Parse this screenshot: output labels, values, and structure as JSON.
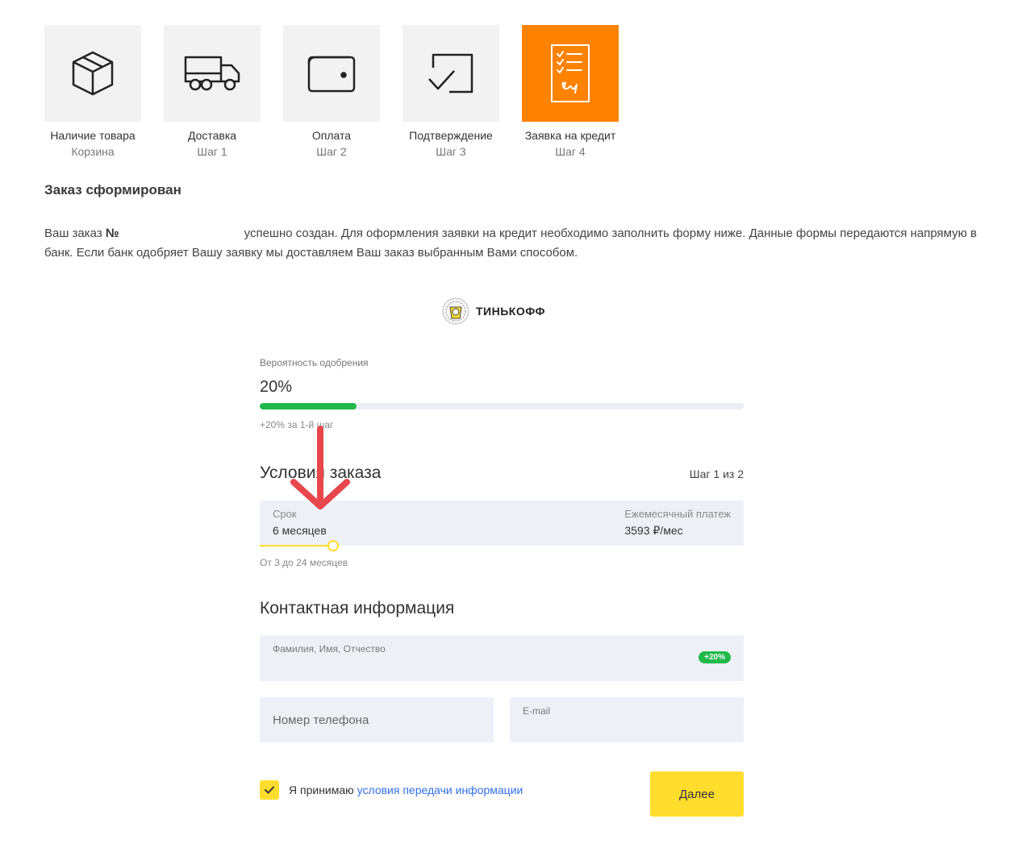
{
  "steps": [
    {
      "title": "Наличие товара",
      "sub": "Корзина",
      "icon": "box-icon",
      "active": false
    },
    {
      "title": "Доставка",
      "sub": "Шаг 1",
      "icon": "truck-icon",
      "active": false
    },
    {
      "title": "Оплата",
      "sub": "Шаг 2",
      "icon": "wallet-icon",
      "active": false
    },
    {
      "title": "Подтверждение",
      "sub": "Шаг 3",
      "icon": "confirm-icon",
      "active": false
    },
    {
      "title": "Заявка на кредит",
      "sub": "Шаг 4",
      "icon": "credit-application-icon",
      "active": true
    }
  ],
  "order": {
    "heading": "Заказ сформирован",
    "text_before": "Ваш заказ ",
    "number_label": "№",
    "text_after": "успешно создан. Для оформления заявки на кредит необходимо заполнить форму ниже. Данные формы передаются напрямую в банк. Если банк одобряет Вашу заявку мы доставляем Ваш заказ выбранным Вами способом."
  },
  "bank": {
    "name": "ТИНЬКОФФ",
    "icon": "tinkoff-emblem-icon"
  },
  "approval": {
    "label": "Вероятность одобрения",
    "value": "20%",
    "progress_fraction": 0.2,
    "note": "+20% за 1-й шаг"
  },
  "conditions": {
    "title": "Условия заказа",
    "step": "Шаг 1 из 2",
    "term_label": "Срок",
    "term_value": "6 месяцев",
    "payment_label": "Ежемесячный платеж",
    "payment_value": "3593 ₽/мес",
    "range": "От 3 до 24 месяцев"
  },
  "contact": {
    "title": "Контактная информация",
    "fio_label": "Фамилия, Имя, Отчество",
    "fio_badge": "+20%",
    "phone_placeholder": "Номер телефона",
    "email_label": "E-mail"
  },
  "agree": {
    "text": "Я принимаю",
    "link": "условия передачи информации",
    "checked": true
  },
  "next_button": "Далее",
  "colors": {
    "accent": "#ff8200",
    "yellow": "#ffdd2d",
    "green": "#1fb84a",
    "link": "#336fee",
    "annotation": "#e8474b"
  }
}
